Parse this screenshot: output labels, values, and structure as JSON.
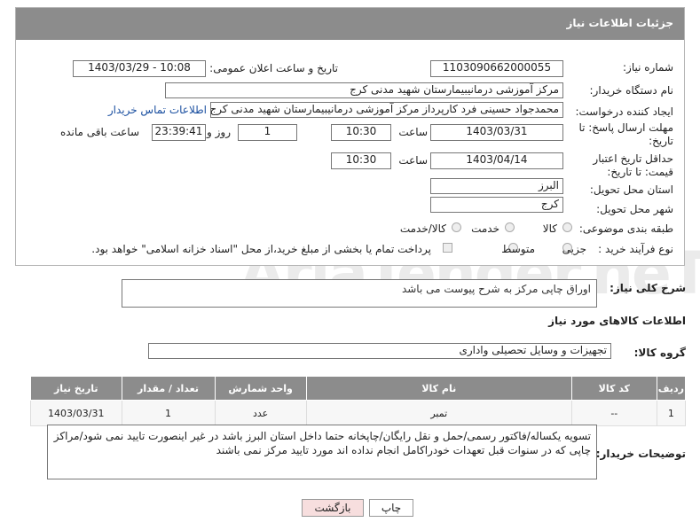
{
  "header": {
    "title": "جزئیات اطلاعات نیاز"
  },
  "fields": {
    "need_number_label": "شماره نیاز:",
    "need_number": "1103090662000055",
    "announce_label": "تاریخ و ساعت اعلان عمومی:",
    "announce_value": "1403/03/29 - 10:08",
    "buyer_org_label": "نام دستگاه خریدار:",
    "buyer_org": "مرکز آموزشی درمانیبیمارستان شهید مدنی کرج",
    "creator_label": "ایجاد کننده درخواست:",
    "creator": "محمدجواد حسینی فرد کارپرداز مرکز آموزشی درمانیبیمارستان شهید مدنی کرج",
    "contact_link": "اطلاعات تماس خریدار",
    "deadline_label": "مهلت ارسال پاسخ: تا تاریخ:",
    "deadline_date": "1403/03/31",
    "time_label": "ساعت",
    "deadline_time": "10:30",
    "days_value": "1",
    "days_label": "روز و",
    "remaining_time": "23:39:41",
    "remaining_label": "ساعت باقی مانده",
    "validity_label": "حداقل تاریخ اعتبار قیمت: تا تاریخ:",
    "validity_date": "1403/04/14",
    "validity_time": "10:30",
    "province_label": "استان محل تحویل:",
    "province": "البرز",
    "city_label": "شهر محل تحویل:",
    "city": "کرج",
    "category_label": "طبقه بندی موضوعی:",
    "category_options": [
      "کالا",
      "خدمت",
      "کالا/خدمت"
    ],
    "process_label": "نوع فرآیند خرید :",
    "process_options": [
      "جزیی",
      "متوسط"
    ],
    "payment_note": "پرداخت تمام یا بخشی از مبلغ خرید،از محل \"اسناد خزانه اسلامی\" خواهد بود."
  },
  "description": {
    "label": "شرح کلی نیاز:",
    "value": "اوراق چاپی مرکز به شرح پیوست می باشد"
  },
  "goods_section": {
    "title": "اطلاعات کالاهای مورد نیاز",
    "group_label": "گروه کالا:",
    "group_value": "تجهیزات و وسایل تحصیلی واداری"
  },
  "table": {
    "headers": [
      "ردیف",
      "کد کالا",
      "نام کالا",
      "واحد شمارش",
      "تعداد / مقدار",
      "تاریخ نیاز"
    ],
    "rows": [
      [
        "1",
        "--",
        "تمبر",
        "عدد",
        "1",
        "1403/03/31"
      ]
    ]
  },
  "buyer_notes": {
    "label": "توضیحات خریدار:",
    "value": "تسویه یکساله/فاکتور رسمی/حمل و نقل رایگان/چاپخانه حتما داخل استان البرز باشد در غیر اینصورت تایید نمی شود/مراکز چاپی که در سنوات قبل تعهدات خودراکامل انجام نداده اند مورد تایید مرکز نمی باشند"
  },
  "buttons": {
    "print": "چاپ",
    "back": "بازگشت"
  },
  "watermark": "AriaTender.neT",
  "colors": {
    "header": "#8c8c8c",
    "link": "#1a4fa0",
    "back_button": "#f7dede"
  }
}
